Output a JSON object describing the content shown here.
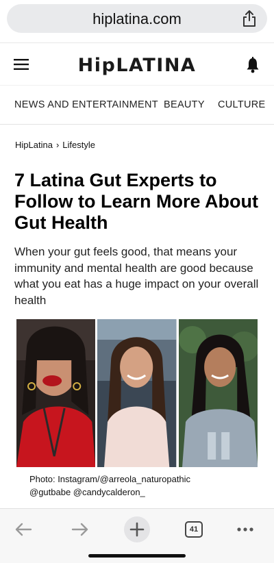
{
  "browser": {
    "url": "hiplatina.com",
    "share_icon": "share-icon",
    "tab_count": "41"
  },
  "site": {
    "logo": "HipLATINA",
    "menu_icon": "hamburger-menu-icon",
    "notification_icon": "bell-icon"
  },
  "nav": {
    "items": [
      "NEWS AND ENTERTAINMENT",
      "BEAUTY",
      "CULTURE"
    ]
  },
  "breadcrumb": {
    "home": "HipLatina",
    "section": "Lifestyle"
  },
  "article": {
    "title": "7 Latina Gut Experts to Follow to Learn More About Gut Health",
    "subtitle": "When your gut feels good, that means your immunity and mental health are good because what you eat has a huge impact on your overall health",
    "caption_line1": "Photo: Instagram/@arreola_naturopathic",
    "caption_line2": "@gutbabe @candycalderon_"
  },
  "toolbar": {
    "back_icon": "back-arrow-icon",
    "forward_icon": "forward-arrow-icon",
    "new_tab_icon": "plus-icon",
    "tabs_icon": "tabs-icon",
    "more_icon": "more-dots-icon"
  },
  "colors": {
    "url_bar_bg": "#e9eaec",
    "toolbar_bg": "#f7f7f7",
    "text": "#111111"
  }
}
